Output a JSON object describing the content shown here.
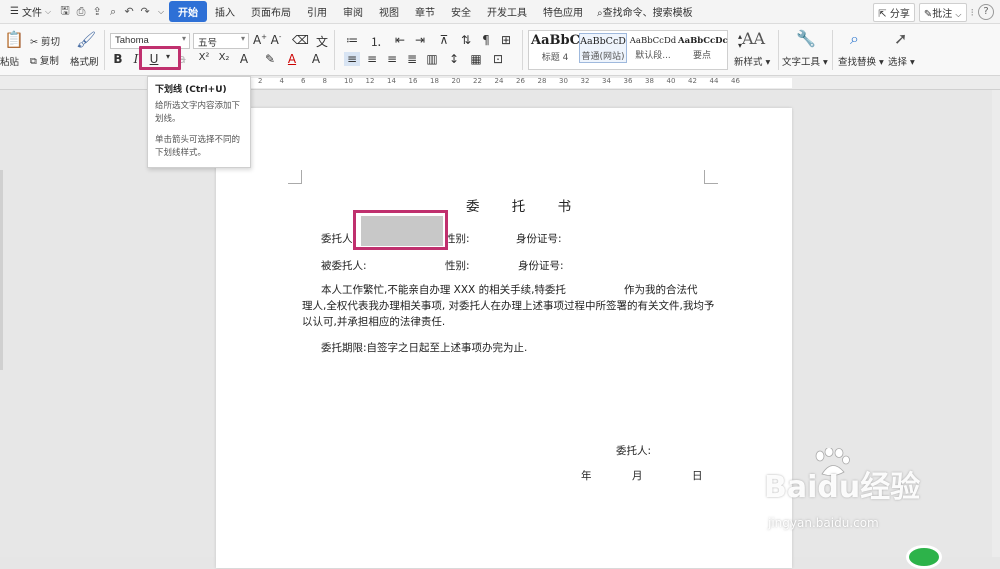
{
  "menubar": {
    "file_label": "文件",
    "tabs": [
      "开始",
      "插入",
      "页面布局",
      "引用",
      "审阅",
      "视图",
      "章节",
      "安全",
      "开发工具",
      "特色应用"
    ],
    "active_tab": "开始",
    "search_label": "查找命令、搜索模板",
    "share_label": "分享",
    "comment_label": "批注",
    "help_label": "?"
  },
  "ribbon": {
    "paste_label": "粘贴",
    "cut_label": "剪切",
    "copy_label": "复制",
    "format_painter_label": "格式刷",
    "font_name": "Tahoma",
    "font_size": "五号",
    "bold": "B",
    "italic": "I",
    "underline": "U",
    "superscript": "X²",
    "subscript": "X₂",
    "styles": [
      {
        "sample": "AaBbC",
        "name": "标题 4"
      },
      {
        "sample": "AaBbCcD",
        "name": "普通(网站)"
      },
      {
        "sample": "AaBbCcDd",
        "name": "默认段..."
      },
      {
        "sample": "AaBbCcDc",
        "name": "要点"
      }
    ],
    "new_style_label": "新样式",
    "text_tools_label": "文字工具",
    "find_replace_label": "查找替换",
    "select_label": "选择"
  },
  "ruler": {
    "numbers": [
      "2",
      "4",
      "6",
      "8",
      "10",
      "12",
      "14",
      "16",
      "18",
      "20",
      "22",
      "24",
      "26",
      "28",
      "30",
      "32",
      "34",
      "36",
      "38",
      "40",
      "42",
      "44",
      "46"
    ]
  },
  "tooltip": {
    "title": "下划线 (Ctrl+U)",
    "line1": "给所选文字内容添加下划线。",
    "line2": "单击箭头可选择不同的下划线样式。"
  },
  "document": {
    "title": "委 托 书",
    "row1_label": "委托人:",
    "row1_gender": "性别:",
    "row1_id": "身份证号:",
    "row2_label": "被委托人:",
    "row2_gender": "性别:",
    "row2_id": "身份证号:",
    "para1_line1": "本人工作繁忙,不能亲自办理 XXX 的相关手续,特委托",
    "para1_line1_end": "作为我的合法代",
    "para1_line2": "理人,全权代表我办理相关事项, 对委托人在办理上述事项过程中所签署的有关文件,我均予",
    "para1_line3": "以认可,并承担相应的法律责任.",
    "para2": "委托期限:自签字之日起至上述事项办完为止.",
    "sign_label": "委托人:",
    "date_year": "年",
    "date_month": "月",
    "date_day": "日"
  },
  "watermark": {
    "logo": "Baidu经验",
    "url": "jingyan.baidu.com"
  },
  "colors": {
    "active_tab": "#2e70d6",
    "highlight": "#c0306e"
  }
}
